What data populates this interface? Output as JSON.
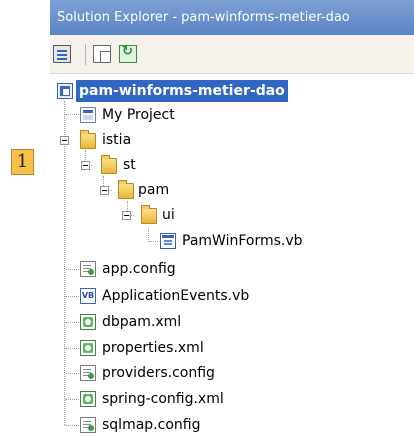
{
  "window": {
    "title": "Solution Explorer - pam-winforms-metier-dao"
  },
  "toolbar": {
    "buttons": [
      {
        "name": "properties",
        "icon": "properties-icon"
      },
      {
        "name": "show-all-files",
        "icon": "show-all-files-icon"
      },
      {
        "name": "refresh",
        "icon": "refresh-icon"
      }
    ]
  },
  "tree": {
    "root": "pam-winforms-metier-dao",
    "items": {
      "my_project": "My Project",
      "istia": "istia",
      "st": "st",
      "pam": "pam",
      "ui": "ui",
      "pamwinforms": "PamWinForms.vb",
      "app_config": "app.config",
      "application_events": "ApplicationEvents.vb",
      "dbpam": "dbpam.xml",
      "properties": "properties.xml",
      "providers": "providers.config",
      "spring_config": "spring-config.xml",
      "sqlmap": "sqlmap.config"
    },
    "expander_symbol": "−",
    "vb_badge": "VB"
  },
  "callout": {
    "label": "1"
  },
  "colors": {
    "title_bar": "#5b84c6",
    "selection": "#3166c5",
    "toolbar_bg": "#f4f2ea",
    "callout": "#f7c04a"
  }
}
